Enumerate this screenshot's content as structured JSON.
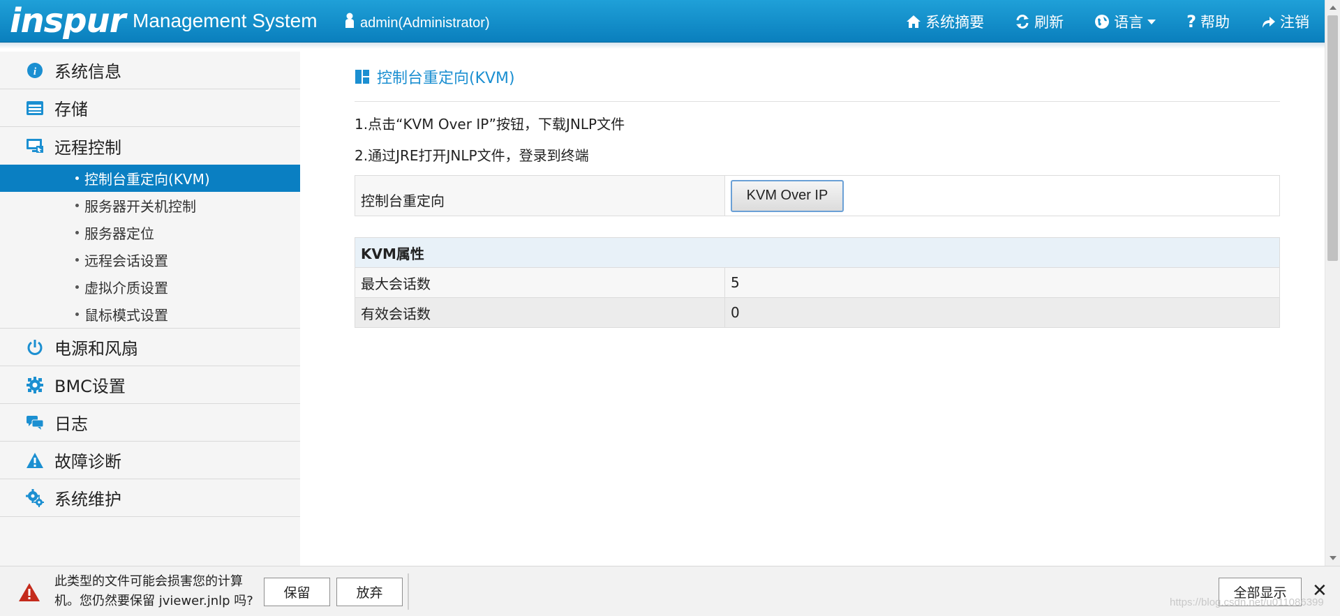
{
  "header": {
    "logo": "inspur",
    "title": "Management System",
    "user": "admin(Administrator)",
    "nav": [
      {
        "label": "系统摘要",
        "icon": "home-icon"
      },
      {
        "label": "刷新",
        "icon": "refresh-icon"
      },
      {
        "label": "语言",
        "icon": "globe-icon"
      },
      {
        "label": "帮助",
        "icon": "help-icon"
      },
      {
        "label": "注销",
        "icon": "logout-icon"
      }
    ]
  },
  "sidebar": {
    "items": [
      {
        "label": "系统信息",
        "icon": "info-icon"
      },
      {
        "label": "存储",
        "icon": "storage-icon"
      },
      {
        "label": "远程控制",
        "icon": "monitor-icon"
      },
      {
        "label": "电源和风扇",
        "icon": "power-icon"
      },
      {
        "label": "BMC设置",
        "icon": "gear-icon"
      },
      {
        "label": "日志",
        "icon": "chat-icon"
      },
      {
        "label": "故障诊断",
        "icon": "warning-icon"
      },
      {
        "label": "系统维护",
        "icon": "gears-icon"
      }
    ],
    "submenu": [
      {
        "label": "控制台重定向(KVM)",
        "active": true
      },
      {
        "label": "服务器开关机控制"
      },
      {
        "label": "服务器定位"
      },
      {
        "label": "远程会话设置"
      },
      {
        "label": "虚拟介质设置"
      },
      {
        "label": "鼠标模式设置"
      }
    ]
  },
  "main": {
    "title": "控制台重定向(KVM)",
    "steps": [
      "1.点击“KVM Over IP”按钮，下载JNLP文件",
      "2.通过JRE打开JNLP文件，登录到终端"
    ],
    "console": {
      "label": "控制台重定向",
      "button": "KVM Over IP"
    },
    "properties": {
      "header": "KVM属性",
      "rows": [
        {
          "label": "最大会话数",
          "value": "5"
        },
        {
          "label": "有效会话数",
          "value": "0"
        }
      ]
    }
  },
  "download_bar": {
    "message_line1": "此类型的文件可能会损害您的计算",
    "message_line2": "机。您仍然要保留 jviewer.jnlp 吗?",
    "keep": "保留",
    "discard": "放弃",
    "show_all": "全部显示",
    "close": "✕"
  },
  "watermark": "https://blog.csdn.net/u011086399",
  "colors": {
    "header": "#0a7fbd",
    "accent": "#1b8fd1",
    "active": "#0a7fc2"
  }
}
